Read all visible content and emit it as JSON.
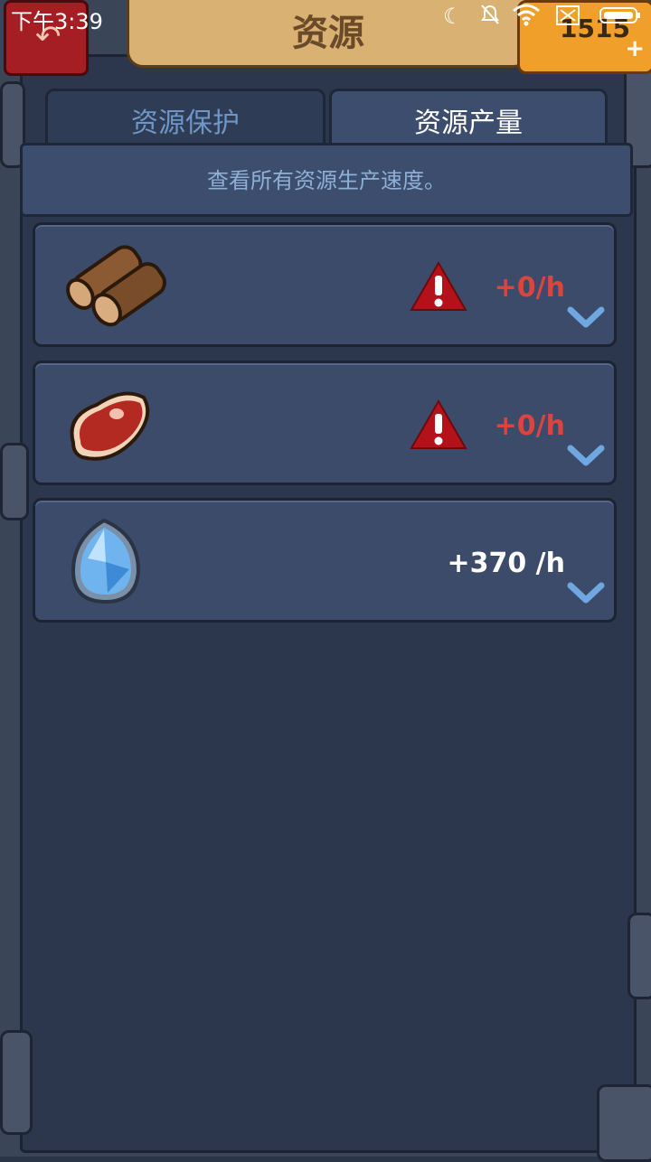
{
  "status_bar": {
    "time": "下午3:39",
    "icons": [
      "moon-icon",
      "mute-icon",
      "wifi-icon",
      "sim-icon",
      "battery-icon"
    ]
  },
  "header": {
    "title": "资源",
    "back_icon": "back-arrow-icon",
    "gem_count": "1515",
    "plus": "+"
  },
  "tabs": [
    {
      "label": "资源保护",
      "active": false
    },
    {
      "label": "资源产量",
      "active": true
    }
  ],
  "description": "查看所有资源生产速度。",
  "resources": [
    {
      "icon": "wood-icon",
      "warning": true,
      "rate": "+0/h"
    },
    {
      "icon": "meat-icon",
      "warning": true,
      "rate": "+0/h"
    },
    {
      "icon": "crystal-icon",
      "warning": false,
      "rate": "+370 /h"
    }
  ],
  "colors": {
    "warning": "#d9453f",
    "accent": "#6fa8e0",
    "panel": "#3d4b6a"
  }
}
